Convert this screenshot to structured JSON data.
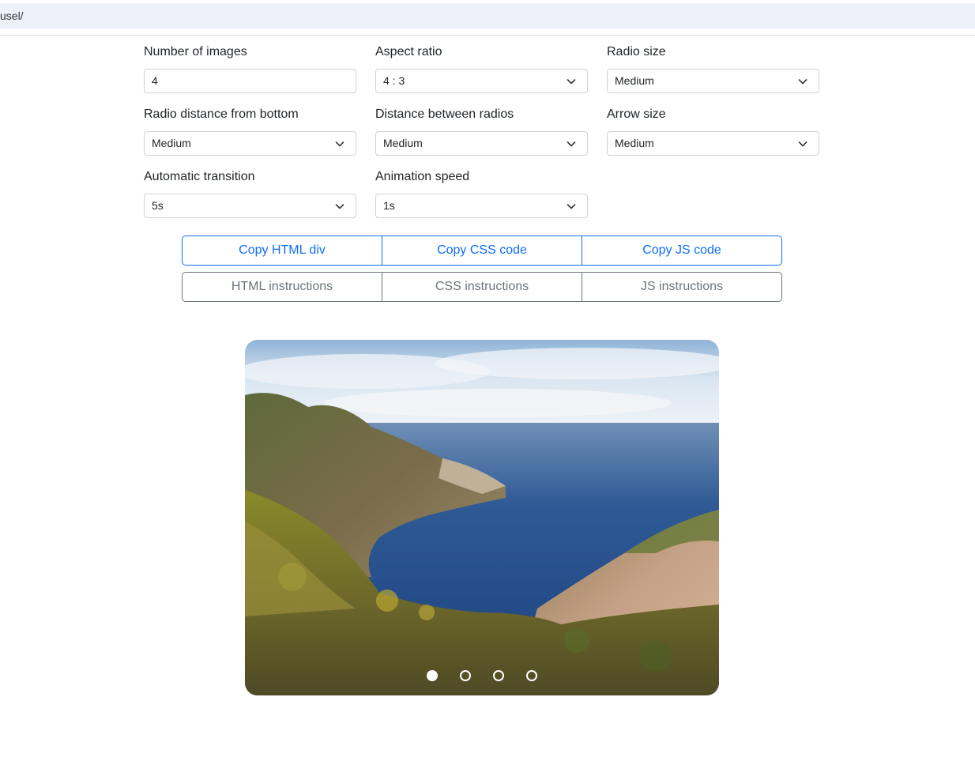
{
  "browser": {
    "address_text": "usel/"
  },
  "form": {
    "number_of_images": {
      "label": "Number of images",
      "value": "4"
    },
    "aspect_ratio": {
      "label": "Aspect ratio",
      "value": "4 : 3"
    },
    "radio_size": {
      "label": "Radio size",
      "value": "Medium"
    },
    "radio_distance_bottom": {
      "label": "Radio distance from bottom",
      "value": "Medium"
    },
    "distance_between_radios": {
      "label": "Distance between radios",
      "value": "Medium"
    },
    "arrow_size": {
      "label": "Arrow size",
      "value": "Medium"
    },
    "automatic_transition": {
      "label": "Automatic transition",
      "value": "5s"
    },
    "animation_speed": {
      "label": "Animation speed",
      "value": "1s"
    }
  },
  "copy_buttons": [
    {
      "label": "Copy HTML div"
    },
    {
      "label": "Copy CSS code"
    },
    {
      "label": "Copy JS code"
    }
  ],
  "instruction_buttons": [
    {
      "label": "HTML instructions"
    },
    {
      "label": "CSS instructions"
    },
    {
      "label": "JS instructions"
    }
  ],
  "carousel": {
    "image_count": 4,
    "active_index": 0
  },
  "colors": {
    "primary": "#0d6efd",
    "secondary": "#6c757d",
    "address_bar_bg": "#eef1f9"
  }
}
